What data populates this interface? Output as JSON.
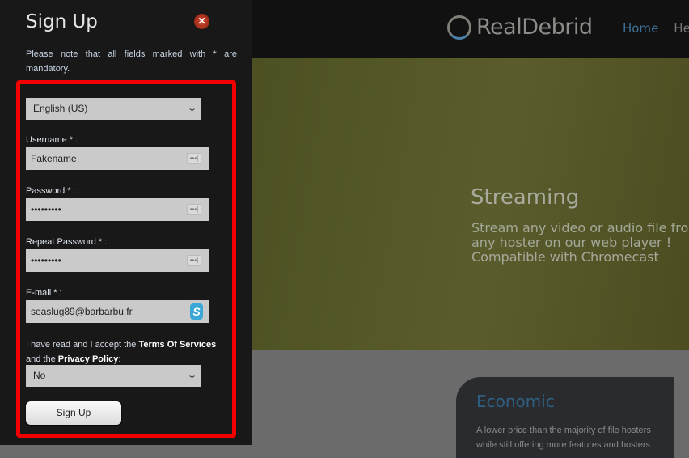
{
  "signup": {
    "title": "Sign Up",
    "close_icon": "close-icon",
    "note": "Please note that all fields marked with * are mandatory.",
    "language": "English (US)",
    "username_label": "Username * :",
    "username_value": "Fakename",
    "password_label": "Password * :",
    "password_value": "•••••••••",
    "repeat_label": "Repeat Password * :",
    "repeat_value": "•••••••••",
    "email_label": "E-mail * :",
    "email_value": "seaslug89@barbarbu.fr",
    "terms_pre": "I have read and I accept the ",
    "terms_link": "Terms Of Services",
    "terms_mid": " and the ",
    "privacy_link": "Privacy Policy",
    "terms_post": ":",
    "accept_value": "No",
    "submit": "Sign Up",
    "highlight_color": "#f20000"
  },
  "site": {
    "logo": "RealDebrid",
    "nav": [
      "Home",
      "He"
    ],
    "streaming_title": "Streaming",
    "streaming_lines": [
      "Stream any video or audio file fro",
      "any hoster on our web player !",
      "Compatible with Chromecast"
    ],
    "economic_title": "Economic",
    "economic_lines": [
      "A lower price than the majority of file hosters",
      "while still offering more features and hosters"
    ]
  }
}
